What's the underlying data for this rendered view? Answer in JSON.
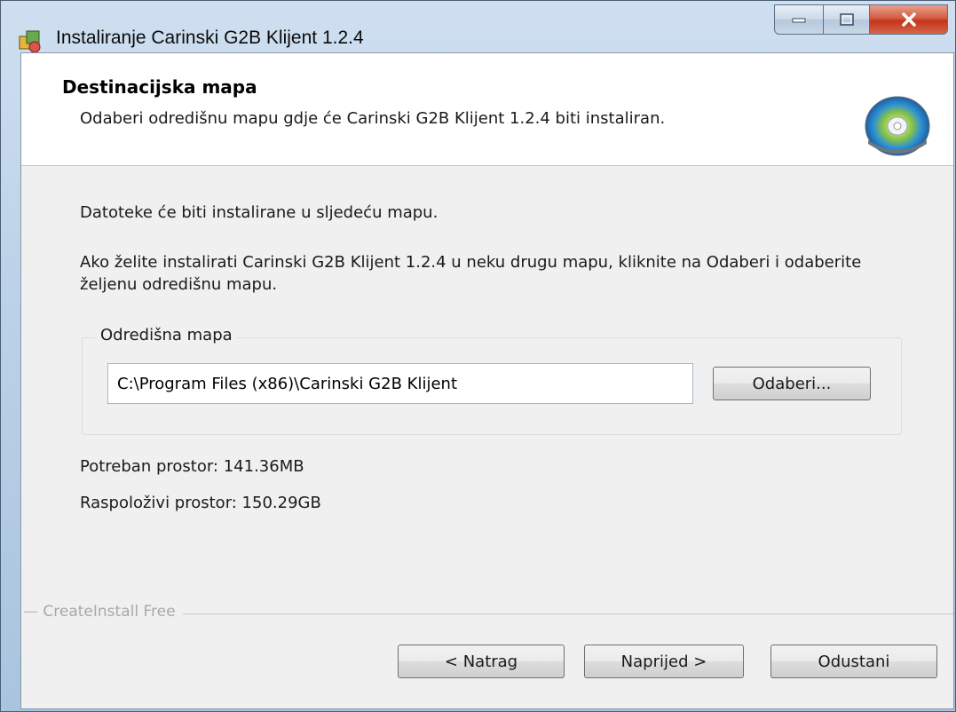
{
  "window": {
    "title": "Instaliranje Carinski G2B Klijent 1.2.4",
    "controls": {
      "minimize": "minimize",
      "maximize": "maximize",
      "close": "close"
    }
  },
  "header": {
    "title": "Destinacijska mapa",
    "subtitle": "Odaberi odredišnu mapu gdje će Carinski G2B Klijent 1.2.4 biti instaliran.",
    "icon": "cd-disc-icon"
  },
  "body": {
    "intro": "Datoteke će biti instalirane u sljedeću mapu.",
    "instruction": "Ako želite instalirati Carinski G2B Klijent 1.2.4 u neku drugu mapu, kliknite na Odaberi i odaberite željenu odredišnu mapu."
  },
  "destination": {
    "group_label": "Odredišna mapa",
    "path_value": "C:\\Program Files (x86)\\Carinski G2B Klijent",
    "browse_label": "Odaberi..."
  },
  "space": {
    "required": "Potreban prostor: 141.36MB",
    "available": "Raspoloživi prostor: 150.29GB"
  },
  "footer": {
    "brand": "CreateInstall Free",
    "back_label": "< Natrag",
    "next_label": "Naprijed >",
    "cancel_label": "Odustani"
  },
  "colors": {
    "title_bar": "#bcd2e8",
    "client_bg": "#f0f0f0",
    "close_button": "#c1361c"
  }
}
